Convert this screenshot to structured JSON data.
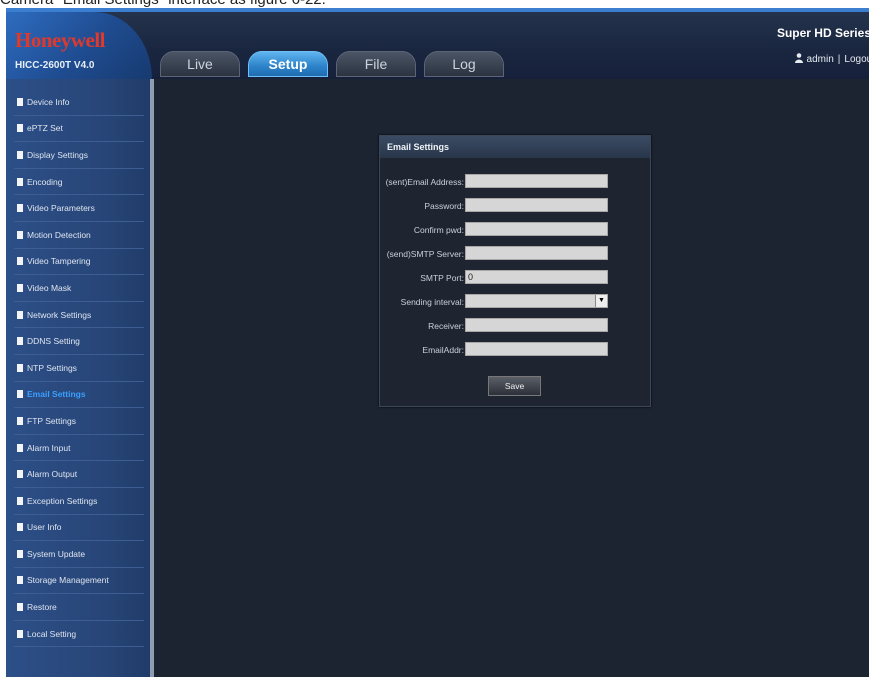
{
  "caption": "Camera \"Email Settings\" interface as figure 6-22.",
  "header": {
    "logo": "Honeywell",
    "model": "HICC-2600T V4.0",
    "series": "Super HD Series",
    "user": "admin",
    "logout": "Logout"
  },
  "tabs": [
    {
      "label": "Live",
      "active": false
    },
    {
      "label": "Setup",
      "active": true
    },
    {
      "label": "File",
      "active": false
    },
    {
      "label": "Log",
      "active": false
    }
  ],
  "sidebar": {
    "items": [
      {
        "label": "Device Info"
      },
      {
        "label": "ePTZ Set"
      },
      {
        "label": "Display Settings"
      },
      {
        "label": "Encoding"
      },
      {
        "label": "Video Parameters"
      },
      {
        "label": "Motion Detection"
      },
      {
        "label": "Video Tampering"
      },
      {
        "label": "Video Mask"
      },
      {
        "label": "Network Settings"
      },
      {
        "label": "DDNS Setting"
      },
      {
        "label": "NTP Settings"
      },
      {
        "label": "Email Settings",
        "active": true
      },
      {
        "label": "FTP Settings"
      },
      {
        "label": "Alarm Input"
      },
      {
        "label": "Alarm Output"
      },
      {
        "label": "Exception Settings"
      },
      {
        "label": "User Info"
      },
      {
        "label": "System Update"
      },
      {
        "label": "Storage Management"
      },
      {
        "label": "Restore"
      },
      {
        "label": "Local Setting"
      }
    ]
  },
  "email_settings": {
    "title": "Email Settings",
    "fields": {
      "sender_address": {
        "label": "(sent)Email Address:",
        "value": ""
      },
      "password": {
        "label": "Password:",
        "value": ""
      },
      "confirm_pwd": {
        "label": "Confirm pwd:",
        "value": ""
      },
      "smtp_server": {
        "label": "(send)SMTP Server:",
        "value": ""
      },
      "smtp_port": {
        "label": "SMTP Port:",
        "value": "0"
      },
      "sending_interval": {
        "label": "Sending interval:",
        "value": ""
      },
      "receiver": {
        "label": "Receiver:",
        "value": ""
      },
      "email_addr": {
        "label": "EmailAddr:",
        "value": ""
      }
    },
    "save_label": "Save"
  }
}
